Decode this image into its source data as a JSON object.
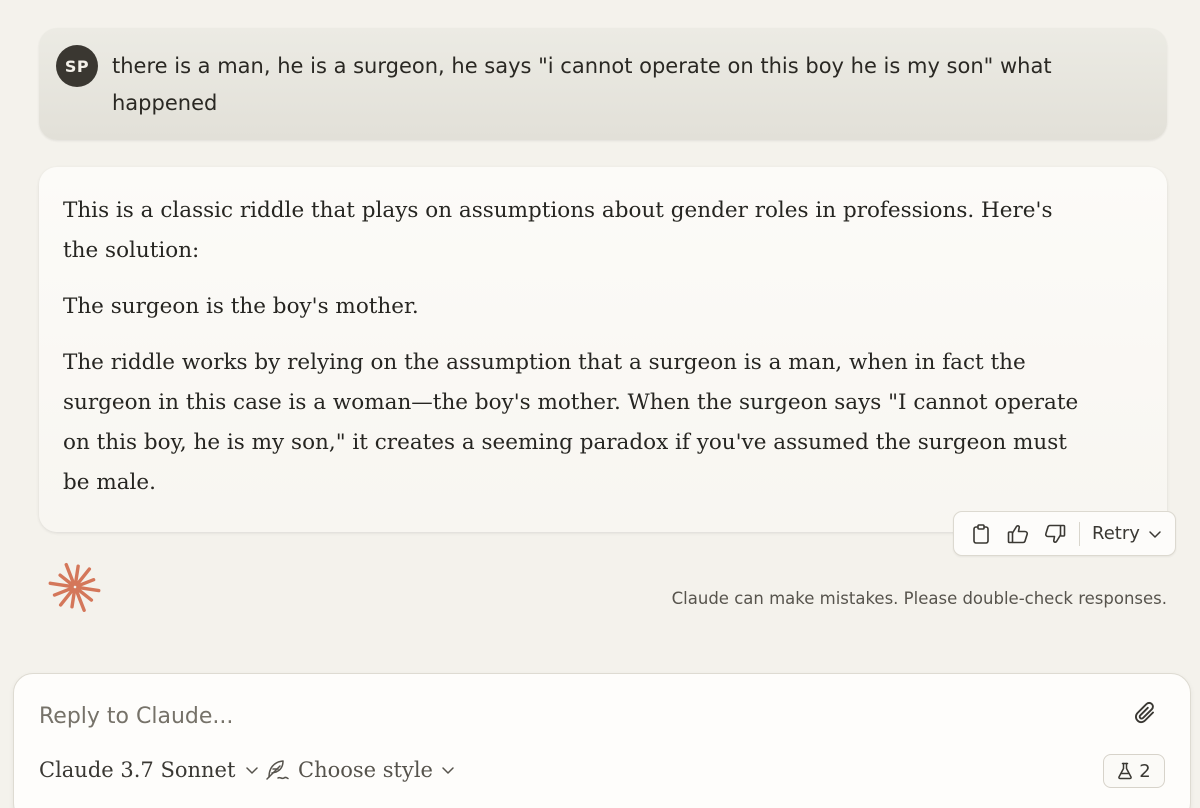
{
  "user_message": {
    "avatar_initials": "SP",
    "text": "there is a man, he is a surgeon, he says \"i cannot operate on this boy he is my son\" what happened"
  },
  "assistant_message": {
    "paragraphs": [
      "This is a classic riddle that plays on assumptions about gender roles in professions. Here's the solution:",
      "The surgeon is the boy's mother.",
      "The riddle works by relying on the assumption that a surgeon is a man, when in fact the surgeon in this case is a woman—the boy's mother. When the surgeon says \"I cannot operate on this boy, he is my son,\" it creates a seeming paradox if you've assumed the surgeon must be male."
    ]
  },
  "actions": {
    "icons": [
      "clipboard-icon",
      "thumbs-up-icon",
      "thumbs-down-icon"
    ],
    "retry_label": "Retry"
  },
  "disclaimer": "Claude can make mistakes. Please double-check responses.",
  "composer": {
    "placeholder": "Reply to Claude...",
    "model_label": "Claude 3.7 Sonnet",
    "style_label": "Choose style",
    "badge_count": "2"
  },
  "colors": {
    "logo": "#d4775a",
    "avatar_bg": "#3a3731",
    "page_bg": "#f4f2ec"
  }
}
